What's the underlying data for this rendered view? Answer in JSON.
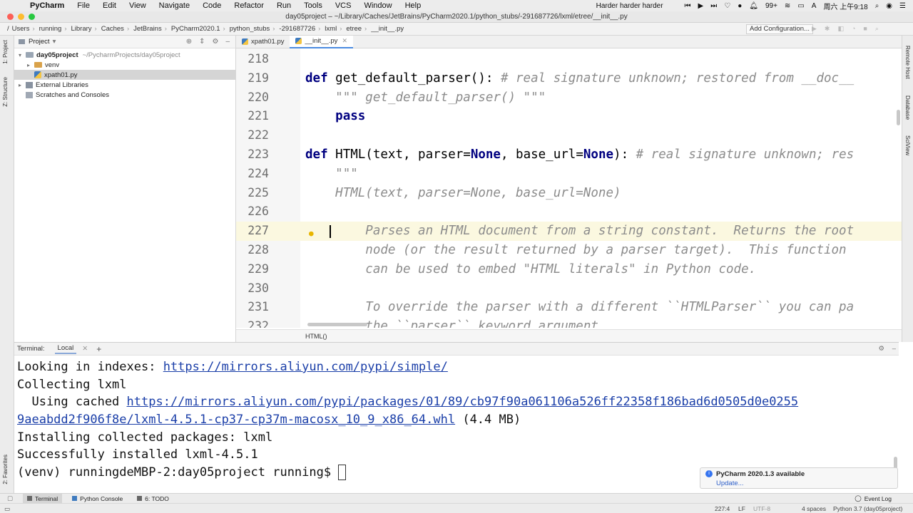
{
  "menubar": {
    "app": "PyCharm",
    "items": [
      "File",
      "Edit",
      "View",
      "Navigate",
      "Code",
      "Refactor",
      "Run",
      "Tools",
      "VCS",
      "Window",
      "Help"
    ],
    "now_playing": "Harder harder harder",
    "badge": "99+",
    "clock": "周六 上午9:18"
  },
  "window": {
    "title": "day05project – ~/Library/Caches/JetBrains/PyCharm2020.1/python_stubs/-291687726/lxml/etree/__init__.py"
  },
  "breadcrumb": [
    "/",
    "Users",
    "running",
    "Library",
    "Caches",
    "JetBrains",
    "PyCharm2020.1",
    "python_stubs",
    "-291687726",
    "lxml",
    "etree",
    "__init__.py"
  ],
  "toolbar": {
    "add_config": "Add Configuration..."
  },
  "left_strip": {
    "project": "1: Project",
    "structure": "Z: Structure",
    "favorites": "2: Favorites"
  },
  "right_strip": {
    "remote": "Remote Host",
    "database": "Database",
    "sciview": "SciView"
  },
  "project_panel": {
    "header": "Project",
    "root": "day05project",
    "root_path": "~/PycharmProjects/day05project",
    "venv": "venv",
    "file": "xpath01.py",
    "ext_libs": "External Libraries",
    "scratches": "Scratches and Consoles"
  },
  "editor_tabs": [
    {
      "label": "xpath01.py",
      "active": false
    },
    {
      "label": "__init__.py",
      "active": true
    }
  ],
  "code": {
    "lines": [
      {
        "n": "218",
        "parts": []
      },
      {
        "n": "219",
        "parts": [
          [
            "kw",
            "def "
          ],
          [
            "t",
            "get_default_parser(): "
          ],
          [
            "cm",
            "# real signature unknown; restored from __doc__"
          ]
        ]
      },
      {
        "n": "220",
        "parts": [
          [
            "t",
            "    "
          ],
          [
            "doc",
            "\"\"\" get_default_parser() \"\"\""
          ]
        ]
      },
      {
        "n": "221",
        "parts": [
          [
            "t",
            "    "
          ],
          [
            "kw",
            "pass"
          ]
        ]
      },
      {
        "n": "222",
        "parts": []
      },
      {
        "n": "223",
        "parts": [
          [
            "kw",
            "def "
          ],
          [
            "t",
            "HTML(text, parser="
          ],
          [
            "kw",
            "None"
          ],
          [
            "t",
            ", base_url="
          ],
          [
            "kw",
            "None"
          ],
          [
            "t",
            "): "
          ],
          [
            "cm",
            "# real signature unknown; res"
          ]
        ]
      },
      {
        "n": "224",
        "parts": [
          [
            "t",
            "    "
          ],
          [
            "doc",
            "\"\"\""
          ]
        ]
      },
      {
        "n": "225",
        "parts": [
          [
            "t",
            "    "
          ],
          [
            "doc",
            "HTML(text, parser=None, base_url=None)"
          ]
        ]
      },
      {
        "n": "226",
        "parts": []
      },
      {
        "n": "227",
        "parts": [
          [
            "t",
            "        "
          ],
          [
            "doc",
            "Parses an HTML document from a string constant.  Returns the root"
          ]
        ]
      },
      {
        "n": "228",
        "parts": [
          [
            "t",
            "        "
          ],
          [
            "doc",
            "node (or the result returned by a parser target).  This function"
          ]
        ]
      },
      {
        "n": "229",
        "parts": [
          [
            "t",
            "        "
          ],
          [
            "doc",
            "can be used to embed \"HTML literals\" in Python code."
          ]
        ]
      },
      {
        "n": "230",
        "parts": []
      },
      {
        "n": "231",
        "parts": [
          [
            "t",
            "        "
          ],
          [
            "doc",
            "To override the parser with a different ``HTMLParser`` you can pa"
          ]
        ]
      },
      {
        "n": "232",
        "parts": [
          [
            "t",
            "        "
          ],
          [
            "doc",
            "the ``parser`` keyword argument"
          ]
        ]
      }
    ],
    "current_line": "227"
  },
  "editor_breadcrumb": "HTML()",
  "terminal": {
    "label": "Terminal:",
    "tab": "Local",
    "lines": [
      {
        "text": "Looking in indexes: ",
        "link": "https://mirrors.aliyun.com/pypi/simple/",
        "after": ""
      },
      {
        "text": "Collecting lxml",
        "link": "",
        "after": ""
      },
      {
        "text": "  Using cached ",
        "link": "https://mirrors.aliyun.com/pypi/packages/01/89/cb97f90a061106a526ff22358f186bad6d0505d0e0255",
        "after": ""
      },
      {
        "text": "",
        "link": "9aeabdd2f906f8e/lxml-4.5.1-cp37-cp37m-macosx_10_9_x86_64.whl",
        "after": " (4.4 MB)"
      },
      {
        "text": "Installing collected packages: lxml",
        "link": "",
        "after": ""
      },
      {
        "text": "Successfully installed lxml-4.5.1",
        "link": "",
        "after": ""
      },
      {
        "text": "(venv) runningdeMBP-2:day05project running$ ",
        "link": "",
        "after": ""
      }
    ]
  },
  "notification": {
    "title": "PyCharm 2020.1.3 available",
    "action": "Update..."
  },
  "bottom_tabs": {
    "terminal": "Terminal",
    "python_console": "Python Console",
    "todo": "6: TODO",
    "event_log": "Event Log"
  },
  "status": {
    "position": "227:4",
    "line_sep": "LF",
    "encoding": "UTF-8",
    "indent": "4 spaces",
    "interpreter": "Python 3.7 (day05project)"
  },
  "colors": {
    "keyword": "#000080",
    "comment": "#8c8c8c",
    "link": "#1a3ea8",
    "current_line": "#fbf8e0"
  }
}
